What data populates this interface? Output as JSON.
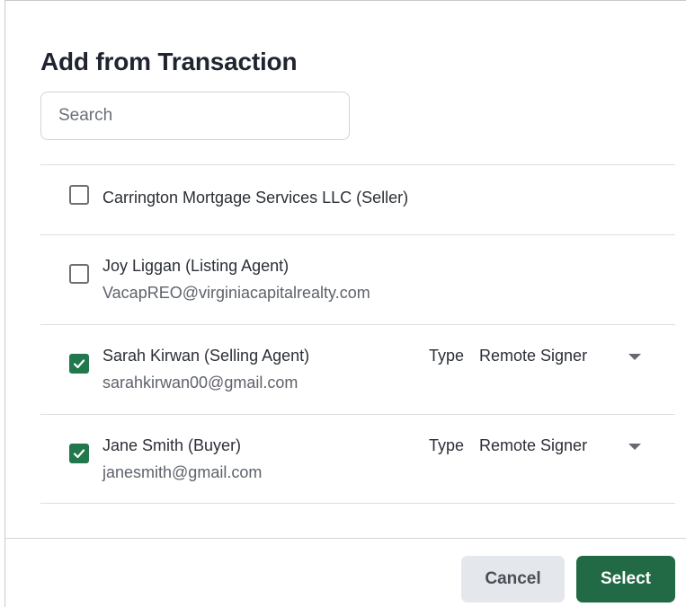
{
  "dialog": {
    "title": "Add from Transaction"
  },
  "search": {
    "placeholder": "Search",
    "value": ""
  },
  "colors": {
    "accent": "#226a45",
    "checkbox_checked": "#21784c",
    "cancel_bg": "#e4e7eb"
  },
  "participants": [
    {
      "name": "Carrington Mortgage Services LLC (Seller)",
      "email": "",
      "checked": false
    },
    {
      "name": "Joy Liggan (Listing Agent)",
      "email": "VacapREO@virginiacapitalrealty.com",
      "checked": false
    },
    {
      "name": "Sarah Kirwan (Selling Agent)",
      "email": "sarahkirwan00@gmail.com",
      "checked": true,
      "type_label": "Type",
      "type_value": "Remote Signer"
    },
    {
      "name": "Jane Smith (Buyer)",
      "email": "janesmith@gmail.com",
      "checked": true,
      "type_label": "Type",
      "type_value": "Remote Signer"
    }
  ],
  "footer": {
    "cancel_label": "Cancel",
    "select_label": "Select"
  },
  "icons": {
    "check": "checkmark-icon",
    "dropdown": "caret-down-icon"
  }
}
